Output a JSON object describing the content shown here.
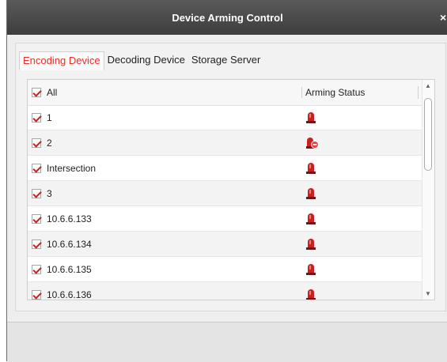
{
  "window": {
    "title": "Device Arming Control",
    "close_glyph": "×"
  },
  "tabs": [
    {
      "label": "Encoding Device",
      "active": true
    },
    {
      "label": "Decoding Device",
      "active": false
    },
    {
      "label": "Storage Server",
      "active": false
    }
  ],
  "table": {
    "select_all_label": "All",
    "status_header": "Arming Status",
    "rows": [
      {
        "name": "1",
        "status_icon": "alarm-icon"
      },
      {
        "name": "2",
        "status_icon": "alarm-disarmed-icon"
      },
      {
        "name": "Intersection",
        "status_icon": "alarm-icon"
      },
      {
        "name": "3",
        "status_icon": "alarm-icon"
      },
      {
        "name": "10.6.6.133",
        "status_icon": "alarm-icon"
      },
      {
        "name": "10.6.6.134",
        "status_icon": "alarm-icon"
      },
      {
        "name": "10.6.6.135",
        "status_icon": "alarm-icon"
      },
      {
        "name": "10.6.6.136",
        "status_icon": "alarm-icon"
      }
    ]
  },
  "colors": {
    "accent_red": "#e8302a",
    "title_bar": "#4a4a4a",
    "alarm_red": "#cc1f1f"
  }
}
